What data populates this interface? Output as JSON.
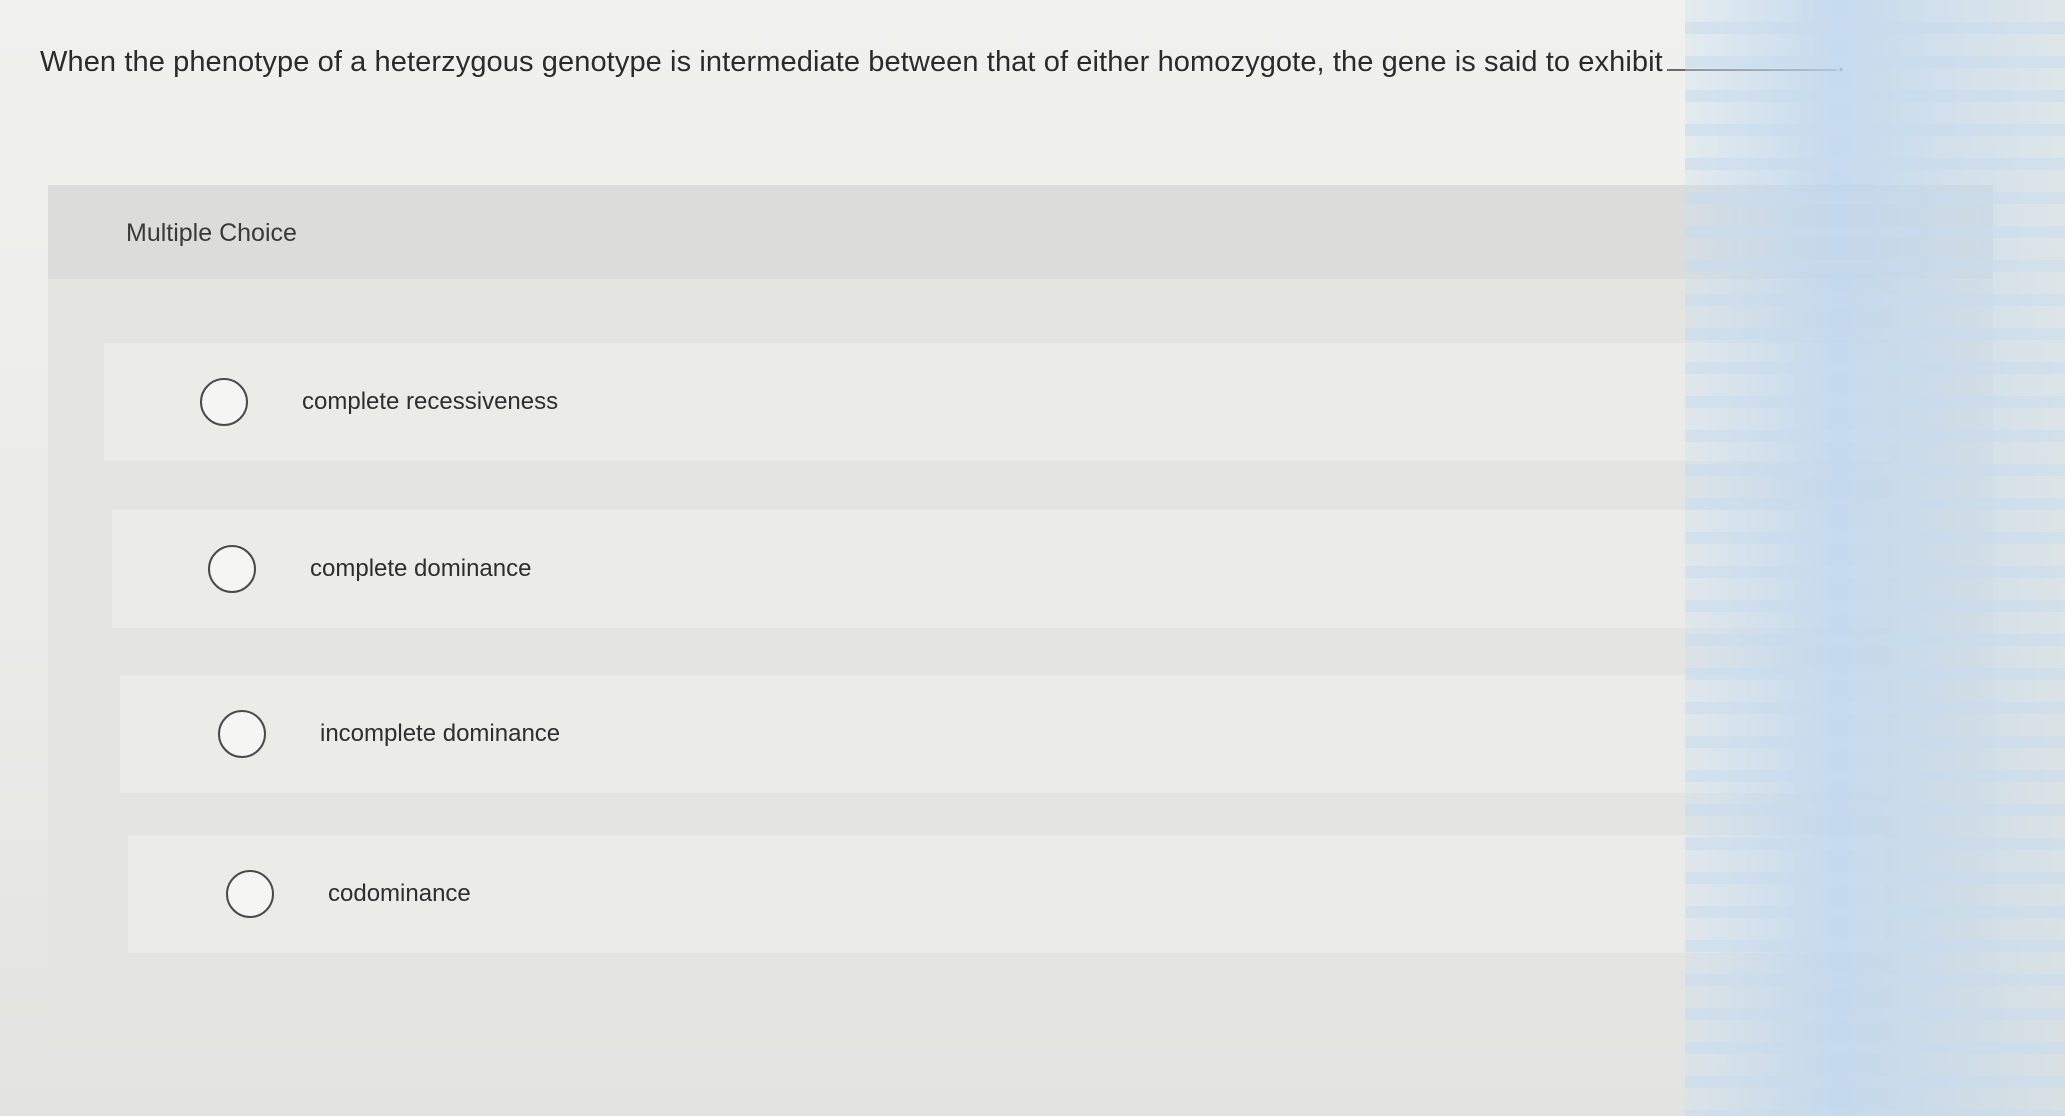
{
  "question": {
    "text": "When the phenotype of a heterzygous genotype is intermediate between that of either homozygote, the gene is said to exhibit",
    "end_punctuation": "."
  },
  "multiple_choice": {
    "header": "Multiple Choice",
    "options": [
      {
        "label": "complete recessiveness",
        "selected": false
      },
      {
        "label": "complete dominance",
        "selected": false
      },
      {
        "label": "incomplete dominance",
        "selected": false
      },
      {
        "label": "codominance",
        "selected": false
      }
    ]
  }
}
